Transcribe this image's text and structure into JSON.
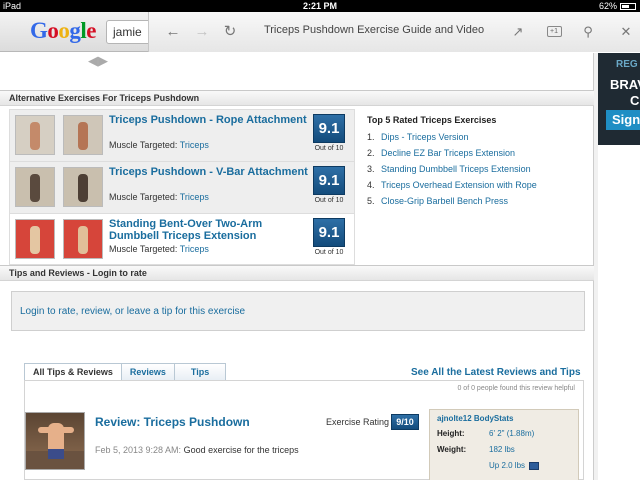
{
  "status_bar": {
    "device": "iPad",
    "time": "2:21 PM",
    "battery": "62%",
    "battery_level": 0.62
  },
  "browser": {
    "search_value": "jamie",
    "page_title": "Triceps Pushdown Exercise Guide and Video",
    "logo_letters": [
      {
        "ch": "G",
        "color": "#3369e8"
      },
      {
        "ch": "o",
        "color": "#d50f25"
      },
      {
        "ch": "o",
        "color": "#eeb211"
      },
      {
        "ch": "g",
        "color": "#3369e8"
      },
      {
        "ch": "l",
        "color": "#009925"
      },
      {
        "ch": "e",
        "color": "#d50f25"
      }
    ]
  },
  "alternatives": {
    "header": "Alternative Exercises For Triceps Pushdown",
    "items": [
      {
        "title": "Triceps Pushdown - Rope Attachment",
        "muscle_label": "Muscle Targeted:",
        "muscle": "Triceps",
        "rating": "9.1",
        "rating_sub": "Out of 10"
      },
      {
        "title": "Triceps Pushdown - V-Bar Attachment",
        "muscle_label": "Muscle Targeted:",
        "muscle": "Triceps",
        "rating": "9.1",
        "rating_sub": "Out of 10"
      },
      {
        "title": "Standing Bent-Over Two-Arm Dumbbell Triceps Extension",
        "muscle_label": "Muscle Targeted:",
        "muscle": "Triceps",
        "rating": "9.1",
        "rating_sub": "Out of 10"
      }
    ]
  },
  "top5": {
    "title": "Top 5 Rated Triceps Exercises",
    "items": [
      {
        "num": "1.",
        "label": "Dips - Triceps Version"
      },
      {
        "num": "2.",
        "label": "Decline EZ Bar Triceps Extension"
      },
      {
        "num": "3.",
        "label": "Standing Dumbbell Triceps Extension"
      },
      {
        "num": "4.",
        "label": "Triceps Overhead Extension with Rope"
      },
      {
        "num": "5.",
        "label": "Close-Grip Barbell Bench Press"
      }
    ]
  },
  "tips": {
    "header": "Tips and Reviews - Login to rate",
    "login_text": "Login to rate, review, or leave a tip for this exercise",
    "tabs": [
      "All Tips & Reviews",
      "Reviews",
      "Tips"
    ],
    "see_all": "See All the Latest Reviews and Tips",
    "helpful": "0 of 0 people found this review helpful",
    "review": {
      "title": "Review: Triceps Pushdown",
      "date": "Feb 5, 2013 9:28 AM:",
      "text": "Good exercise for the triceps",
      "rating_label": "Exercise Rating",
      "rating": "9/10"
    },
    "bodystats": {
      "user": "ajnolte12 BodyStats",
      "height_label": "Height:",
      "height": "6' 2\" (1.88m)",
      "weight_label": "Weight:",
      "weight": "182 lbs",
      "change": "Up 2.0 lbs"
    }
  },
  "ad": {
    "line1": "REG",
    "line2": "BRAV",
    "line3": "C",
    "button": "Sign"
  }
}
